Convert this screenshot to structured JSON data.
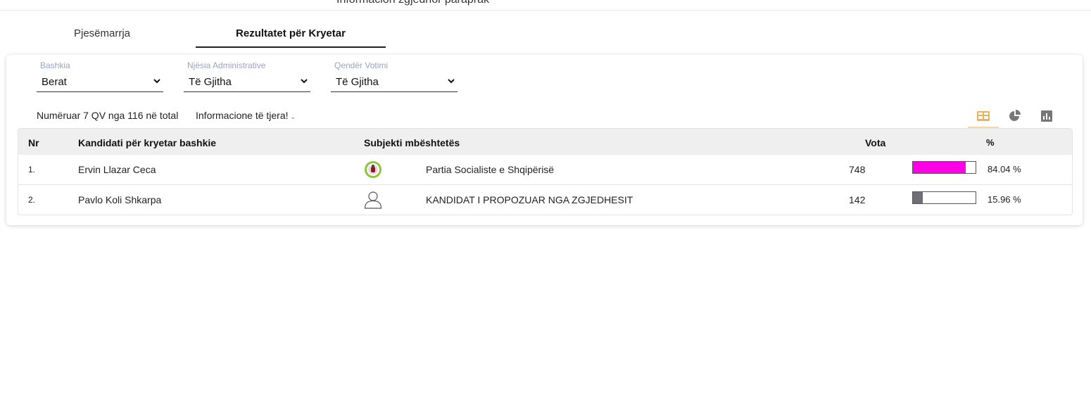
{
  "header": {
    "title": "Informacion zgjedhor paraprak"
  },
  "tabs": [
    {
      "label": "Pjesëmarrja",
      "active": false
    },
    {
      "label": "Rezultatet për Kryetar",
      "active": true
    }
  ],
  "filters": [
    {
      "label": "Bashkia",
      "value": "Berat"
    },
    {
      "label": "Njësia Administrative",
      "value": "Të Gjitha"
    },
    {
      "label": "Qendër Votimi",
      "value": "Të Gjitha"
    }
  ],
  "info": {
    "count_text": "Numëruar 7 QV nga 116 në total",
    "more_text": "Informacione të tjera!"
  },
  "view_icons": [
    "table-view-icon",
    "pie-chart-icon",
    "bar-chart-icon"
  ],
  "table": {
    "headers": {
      "nr": "Nr",
      "candidate": "Kandidati për kryetar bashkie",
      "subject": "Subjekti mbështetës",
      "votes": "Vota",
      "percent": "%"
    },
    "rows": [
      {
        "nr": "1.",
        "candidate": "Ervin Llazar Ceca",
        "logo_icon": "ps-party-logo-icon",
        "subject": "Partia Socialiste e Shqipërisë",
        "votes": "748",
        "percent": 84.04,
        "percent_text": "84.04 %",
        "bar_color": "#ff00e6"
      },
      {
        "nr": "2.",
        "candidate": "Pavlo Koli Shkarpa",
        "logo_icon": "person-outline-icon",
        "subject": "KANDIDAT I PROPOZUAR NGA ZGJEDHESIT",
        "votes": "142",
        "percent": 15.96,
        "percent_text": "15.96 %",
        "bar_color": "#6c7075"
      }
    ]
  },
  "colors": {
    "accent_underline": "#f3d9a8",
    "table_icon": "#e9b35c",
    "label": "#9aa3c4"
  }
}
